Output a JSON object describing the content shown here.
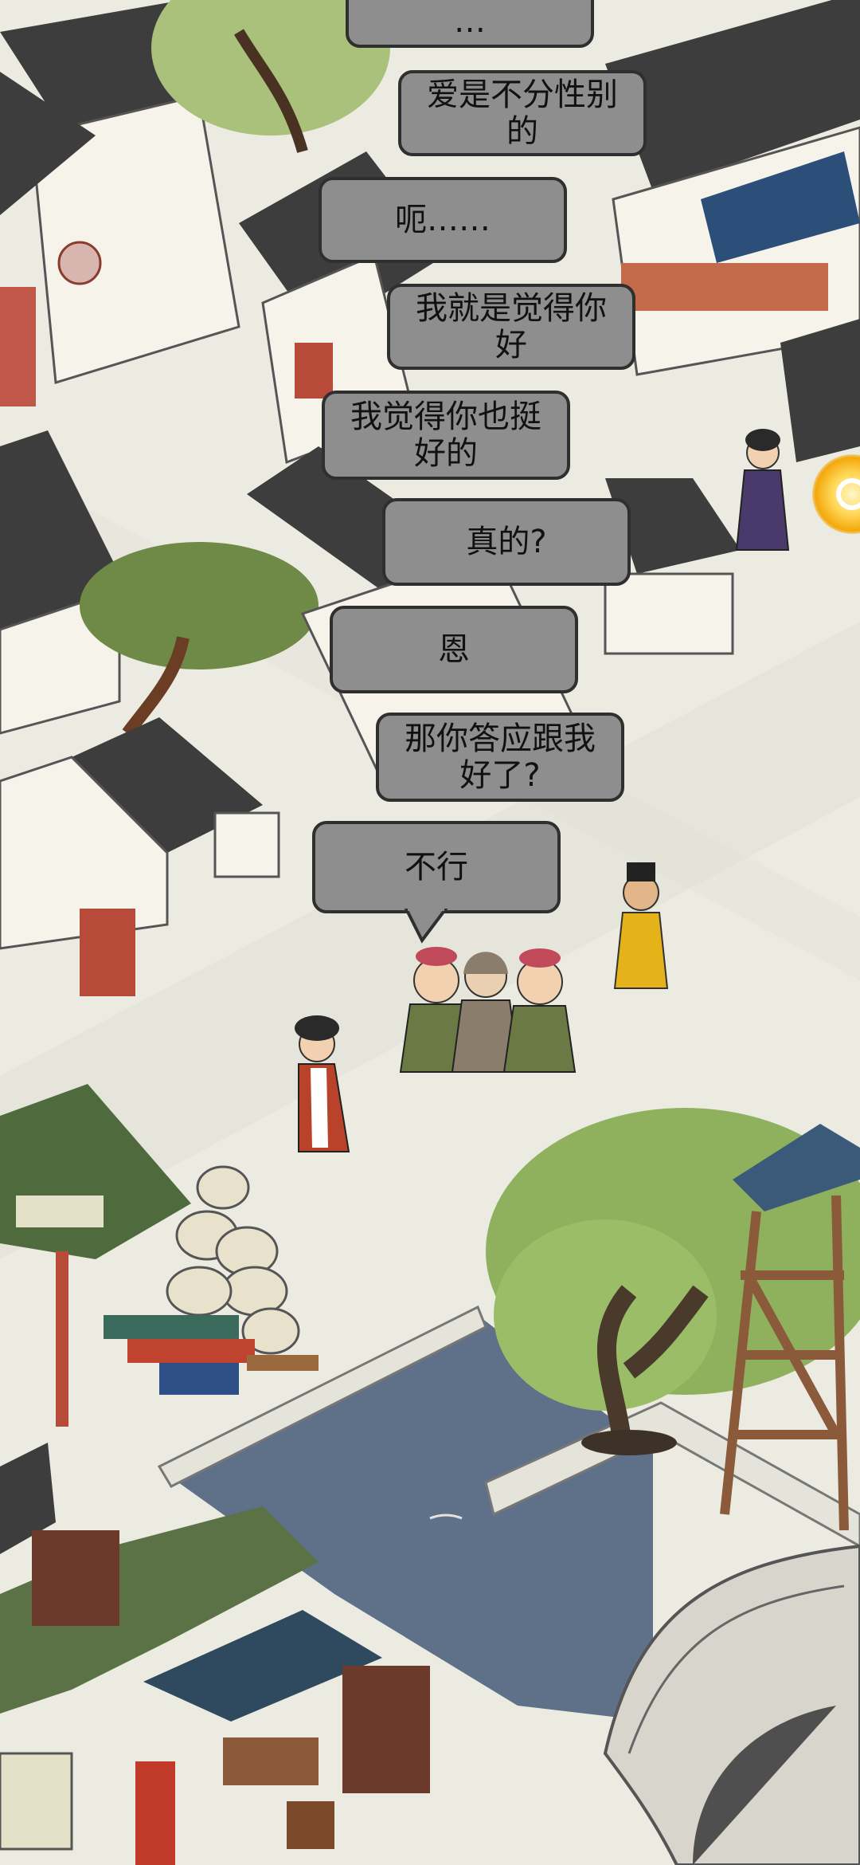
{
  "dialogue": [
    {
      "id": "line-0",
      "text": "…"
    },
    {
      "id": "line-1",
      "text": "爱是不分性别的"
    },
    {
      "id": "line-2",
      "text": "呃……"
    },
    {
      "id": "line-3",
      "text": "我就是觉得你好"
    },
    {
      "id": "line-4",
      "text": "我觉得你也挺好的"
    },
    {
      "id": "line-5",
      "text": "真的?"
    },
    {
      "id": "line-6",
      "text": "恩"
    },
    {
      "id": "line-7",
      "text": "那你答应跟我好了?"
    },
    {
      "id": "line-8",
      "text": "不行"
    }
  ],
  "colors": {
    "ground": "#ecebe2",
    "roof": "#3d3d3d",
    "wall": "#f5f3ea",
    "tree": "#8fb15d",
    "water": "#6f7f93",
    "bubble": "#8e8e8e"
  },
  "characters": [
    {
      "id": "woman-purple",
      "color": "#4a3a6b"
    },
    {
      "id": "official-yellow",
      "color": "#e6b21a"
    },
    {
      "id": "lady-red",
      "color": "#b8432a"
    },
    {
      "id": "matchmaker-left",
      "color": "#6b7a45"
    },
    {
      "id": "nun",
      "color": "#8b7d6b"
    },
    {
      "id": "matchmaker-right",
      "color": "#6b7a45"
    }
  ],
  "reward_orb_icon": "gold-coin-icon"
}
